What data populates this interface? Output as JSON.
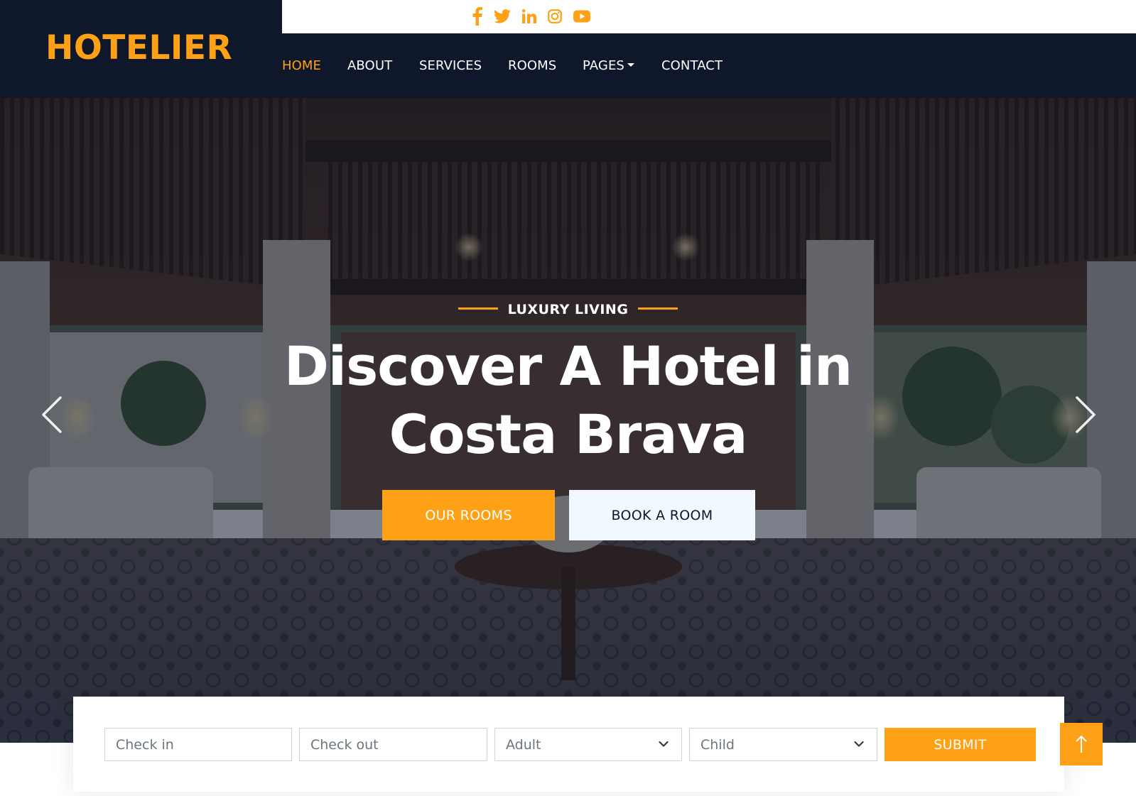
{
  "brand": {
    "name": "HOTELIER"
  },
  "topbar": {
    "social": [
      "facebook-icon",
      "twitter-icon",
      "linkedin-icon",
      "instagram-icon",
      "youtube-icon"
    ]
  },
  "nav": {
    "items": [
      {
        "label": "HOME",
        "active": true
      },
      {
        "label": "ABOUT"
      },
      {
        "label": "SERVICES"
      },
      {
        "label": "ROOMS"
      },
      {
        "label": "PAGES",
        "dropdown": true
      },
      {
        "label": "CONTACT"
      }
    ]
  },
  "hero": {
    "tagline": "LUXURY LIVING",
    "headline_line1": "Discover A Hotel in",
    "headline_line2": "Costa Brava",
    "primary_button": "OUR ROOMS",
    "secondary_button": "BOOK A ROOM",
    "prev_icon": "chevron-left-icon",
    "next_icon": "chevron-right-icon"
  },
  "booking": {
    "check_in_placeholder": "Check in",
    "check_out_placeholder": "Check out",
    "adult_selected": "Adult",
    "child_selected": "Child",
    "submit_label": "SUBMIT"
  },
  "back_to_top": {
    "icon": "arrow-up-icon"
  },
  "colors": {
    "accent": "#fea116",
    "dark": "#0f172b",
    "light": "#f1f8ff"
  }
}
